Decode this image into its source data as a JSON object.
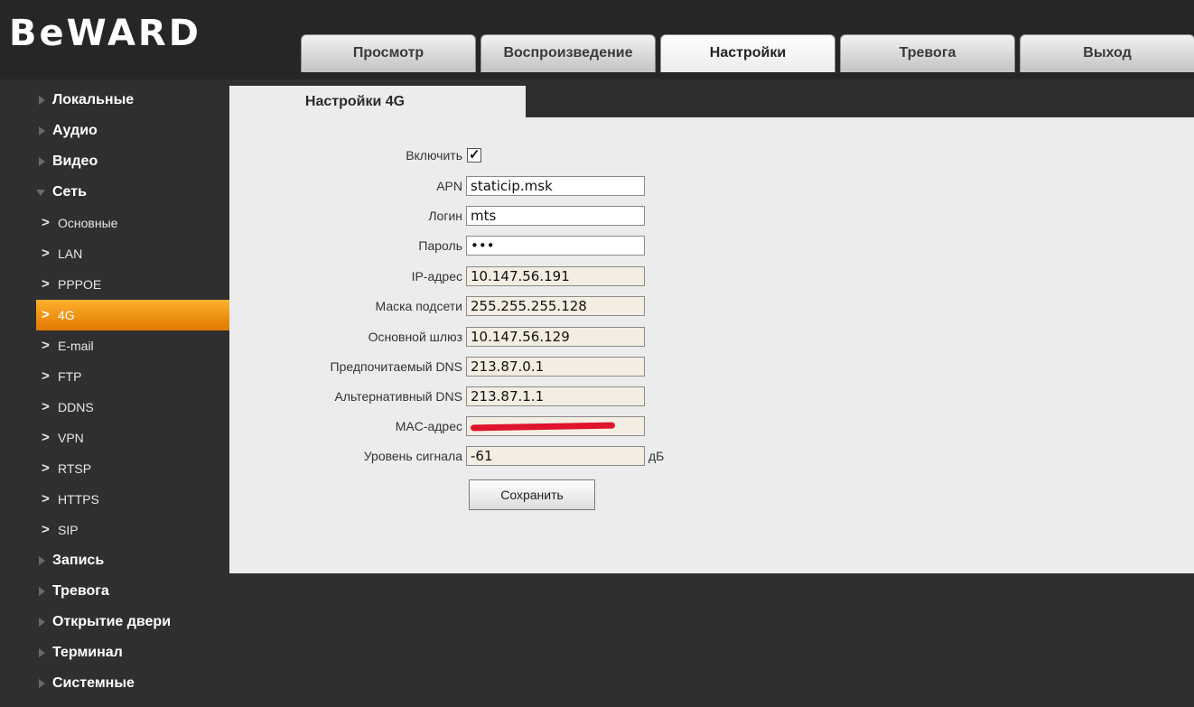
{
  "logo": "BeWARD",
  "tabs": [
    {
      "label": "Просмотр",
      "active": false
    },
    {
      "label": "Воспроизведение",
      "active": false
    },
    {
      "label": "Настройки",
      "active": true
    },
    {
      "label": "Тревога",
      "active": false
    },
    {
      "label": "Выход",
      "active": false
    }
  ],
  "sidebar": {
    "items": [
      {
        "label": "Локальные",
        "level": "top",
        "expanded": false
      },
      {
        "label": "Аудио",
        "level": "top",
        "expanded": false
      },
      {
        "label": "Видео",
        "level": "top",
        "expanded": false
      },
      {
        "label": "Сеть",
        "level": "top",
        "expanded": true
      },
      {
        "label": "Основные",
        "level": "sub"
      },
      {
        "label": "LAN",
        "level": "sub"
      },
      {
        "label": "PPPOE",
        "level": "sub"
      },
      {
        "label": "4G",
        "level": "sub",
        "active": true
      },
      {
        "label": "E-mail",
        "level": "sub"
      },
      {
        "label": "FTP",
        "level": "sub"
      },
      {
        "label": "DDNS",
        "level": "sub"
      },
      {
        "label": "VPN",
        "level": "sub"
      },
      {
        "label": "RTSP",
        "level": "sub"
      },
      {
        "label": "HTTPS",
        "level": "sub"
      },
      {
        "label": "SIP",
        "level": "sub"
      },
      {
        "label": "Запись",
        "level": "top",
        "expanded": false
      },
      {
        "label": "Тревога",
        "level": "top",
        "expanded": false
      },
      {
        "label": "Открытие двери",
        "level": "top",
        "expanded": false
      },
      {
        "label": "Терминал",
        "level": "top",
        "expanded": false
      },
      {
        "label": "Системные",
        "level": "top",
        "expanded": false
      }
    ]
  },
  "panel": {
    "tab": "Настройки 4G",
    "enable": {
      "label": "Включить",
      "checked": true,
      "check_glyph": "✓"
    },
    "apn": {
      "label": "APN",
      "value": "staticip.msk"
    },
    "login": {
      "label": "Логин",
      "value": "mts"
    },
    "password": {
      "label": "Пароль",
      "value": "•••"
    },
    "ip": {
      "label": "IP-адрес",
      "value": "10.147.56.191"
    },
    "mask": {
      "label": "Маска подсети",
      "value": "255.255.255.128"
    },
    "gateway": {
      "label": "Основной шлюз",
      "value": "10.147.56.129"
    },
    "dns1": {
      "label": "Предпочитаемый DNS",
      "value": "213.87.0.1"
    },
    "dns2": {
      "label": "Альтернативный DNS",
      "value": "213.87.1.1"
    },
    "mac": {
      "label": "MAC-адрес",
      "value": ""
    },
    "signal": {
      "label": "Уровень сигнала",
      "value": "-61",
      "unit": "дБ"
    },
    "save_label": "Сохранить"
  },
  "colors": {
    "accent": "#f59a12",
    "background": "#2f2f2f",
    "panel": "#ececec",
    "redaction": "#e0142c"
  }
}
